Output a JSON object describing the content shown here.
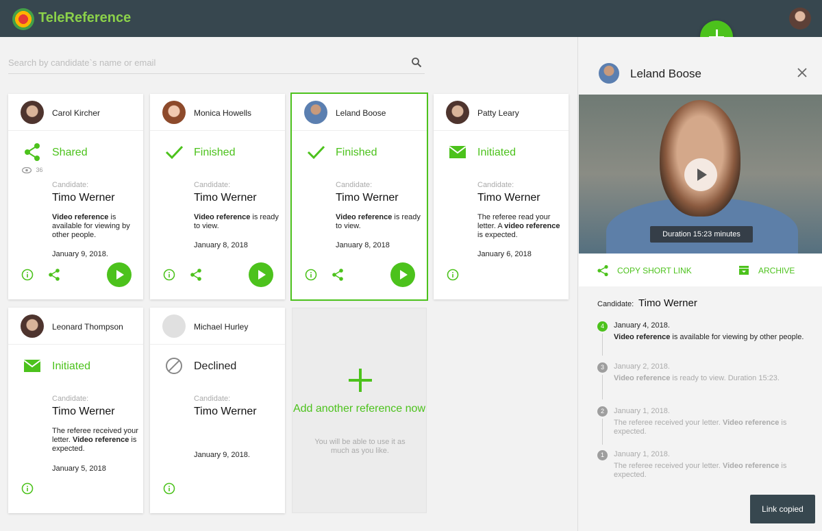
{
  "app": {
    "title": "TeleReference"
  },
  "search": {
    "placeholder": "Search by candidate`s name or email"
  },
  "cards": [
    {
      "name": "Carol Kircher",
      "status": "Shared",
      "views": "36",
      "candidate_label": "Candidate:",
      "candidate": "Timo Werner",
      "desc_bold1": "Video reference",
      "desc_text1": " is available for viewing by other people.",
      "desc_text2": "",
      "desc_bold2": "",
      "desc_text3": "",
      "date": "January 9, 2018."
    },
    {
      "name": "Monica Howells",
      "status": "Finished",
      "candidate_label": "Candidate:",
      "candidate": "Timo Werner",
      "desc_bold1": "Video reference",
      "desc_text1": " is ready to view.",
      "desc_text2": "",
      "desc_bold2": "",
      "desc_text3": "",
      "date": "January 8, 2018"
    },
    {
      "name": "Leland Boose",
      "status": "Finished",
      "candidate_label": "Candidate:",
      "candidate": "Timo Werner",
      "desc_bold1": "Video reference",
      "desc_text1": " is ready to view.",
      "desc_text2": "",
      "desc_bold2": "",
      "desc_text3": "",
      "date": "January 8, 2018"
    },
    {
      "name": "Patty Leary",
      "status": "Initiated",
      "candidate_label": "Candidate:",
      "candidate": "Timo Werner",
      "desc_bold1": "",
      "desc_text1": "",
      "desc_text2": "The referee read your letter. A ",
      "desc_bold2": "video reference",
      "desc_text3": " is expected.",
      "date": "January 6, 2018"
    },
    {
      "name": "Leonard Thompson",
      "status": "Initiated",
      "candidate_label": "Candidate:",
      "candidate": "Timo Werner",
      "desc_bold1": "",
      "desc_text1": "",
      "desc_text2": "The referee received your letter. ",
      "desc_bold2": "Video reference",
      "desc_text3": " is expected.",
      "date": "January 5, 2018"
    },
    {
      "name": "Michael Hurley",
      "status": "Declined",
      "candidate_label": "Candidate:",
      "candidate": "Timo Werner",
      "desc_bold1": "",
      "desc_text1": "",
      "desc_text2": "",
      "desc_bold2": "",
      "desc_text3": "",
      "date": "January 9, 2018."
    }
  ],
  "add_card": {
    "title": "Add another reference now",
    "subtitle": "You will be able to use it as much as you like."
  },
  "panel": {
    "name": "Leland Boose",
    "duration": "Duration 15:23 minutes",
    "copy_link": "COPY SHORT LINK",
    "archive": "ARCHIVE",
    "candidate_label": "Candidate:",
    "candidate": "Timo Werner",
    "timeline": [
      {
        "num": "4",
        "date": "January 4, 2018.",
        "bold": "Video reference",
        "text": " is available for viewing by other people.",
        "pre": "",
        "post": ""
      },
      {
        "num": "3",
        "date": "January 2, 2018.",
        "bold": "Video reference",
        "text": " is ready to view. Duration 15:23.",
        "pre": "",
        "post": ""
      },
      {
        "num": "2",
        "date": "January 1, 2018.",
        "pre": "The referee received your letter. ",
        "bold": "Video reference",
        "text": " is expected.",
        "post": ""
      },
      {
        "num": "1",
        "date": "January 1, 2018.",
        "pre": "The referee received your letter. ",
        "bold": "Video reference",
        "text": " is expected.",
        "post": ""
      }
    ]
  },
  "toast": {
    "text": "Link copied"
  },
  "colors": {
    "accent": "#4cc21c",
    "topbar": "#37474f"
  }
}
